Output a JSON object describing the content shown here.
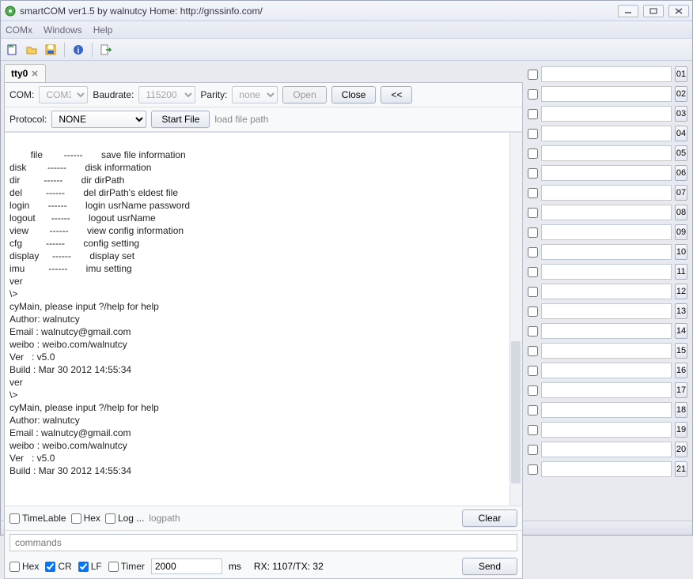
{
  "window": {
    "title": "smartCOM ver1.5 by walnutcy  Home: http://gnssinfo.com/"
  },
  "menu": {
    "com": "COMx",
    "windows": "Windows",
    "help": "Help"
  },
  "tab": {
    "label": "tty0"
  },
  "conn": {
    "com_label": "COM:",
    "com_value": "COM3",
    "baud_label": "Baudrate:",
    "baud_value": "115200",
    "parity_label": "Parity:",
    "parity_value": "none",
    "open": "Open",
    "close": "Close",
    "back": "<<"
  },
  "proto": {
    "label": "Protocol:",
    "value": "NONE",
    "startfile": "Start File",
    "loadpath": "load file path"
  },
  "terminal_text": "file        ------       save file information\ndisk        ------       disk information\ndir         ------       dir dirPath\ndel         ------       del dirPath's eldest file\nlogin       ------       login usrName password\nlogout      ------       logout usrName\nview        ------       view config information\ncfg         ------       config setting\ndisplay     ------       display set\nimu         ------       imu setting\nver\n\\>\ncyMain, please input ?/help for help\nAuthor: walnutcy\nEmail : walnutcy@gmail.com\nweibo : weibo.com/walnutcy\nVer   : v5.0\nBuild : Mar 30 2012 14:55:34\nver\n\\>\ncyMain, please input ?/help for help\nAuthor: walnutcy\nEmail : walnutcy@gmail.com\nweibo : weibo.com/walnutcy\nVer   : v5.0\nBuild : Mar 30 2012 14:55:34",
  "opts": {
    "timelable": "TimeLable",
    "hex1": "Hex",
    "log": "Log ...",
    "logpath": "logpath",
    "clear": "Clear"
  },
  "cmd": {
    "placeholder": "commands"
  },
  "send": {
    "hex": "Hex",
    "cr": "CR",
    "lf": "LF",
    "timer": "Timer",
    "timer_value": "2000",
    "ms": "ms",
    "rxtx_label": "RX:   1107/TX:     32",
    "send": "Send"
  },
  "quick": {
    "rows": [
      "01",
      "02",
      "03",
      "04",
      "05",
      "06",
      "07",
      "08",
      "09",
      "10",
      "11",
      "12",
      "13",
      "14",
      "15",
      "16",
      "17",
      "18",
      "19",
      "20",
      "21"
    ]
  }
}
